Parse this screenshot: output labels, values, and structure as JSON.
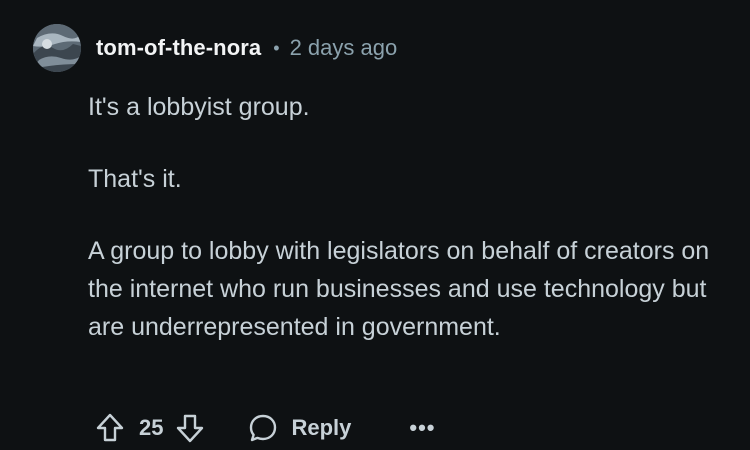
{
  "comment": {
    "username": "tom-of-the-nora",
    "separator": "•",
    "timestamp": "2 days ago",
    "paragraphs": [
      "It's a lobbyist group.",
      "That's it.",
      "A group to lobby with legislators on behalf of creators on the internet who run businesses and use technology but are underrepresented in government."
    ]
  },
  "actions": {
    "score": "25",
    "reply_label": "Reply",
    "more_label": "•••"
  },
  "colors": {
    "background": "#0e1113",
    "username": "#f2f4f5",
    "meta": "#8ba2ad",
    "body_text": "#c7d1d7"
  },
  "icons": {
    "upvote": "arrow-up-outline-icon",
    "downvote": "arrow-down-outline-icon",
    "reply": "speech-bubble-icon",
    "more": "ellipsis-icon"
  }
}
